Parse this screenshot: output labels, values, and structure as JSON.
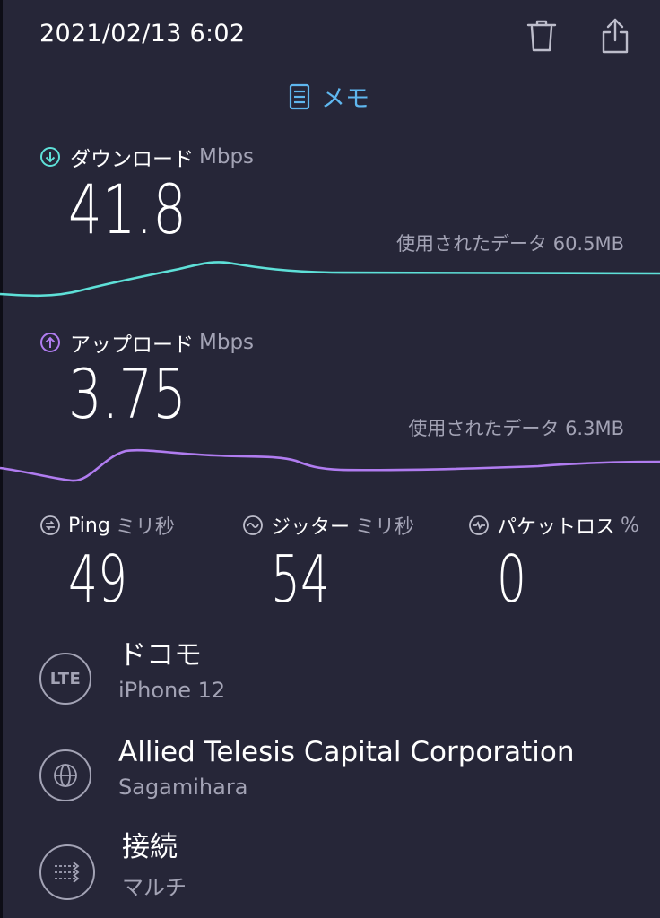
{
  "header": {
    "timestamp": "2021/02/13 6:02",
    "memo_label": "メモ"
  },
  "download": {
    "label": "ダウンロード",
    "unit": "Mbps",
    "value": "41.8",
    "data_used": "使用されたデータ 60.5MB",
    "color": "#5ee0d8"
  },
  "upload": {
    "label": "アップロード",
    "unit": "Mbps",
    "value": "3.75",
    "data_used": "使用されたデータ 6.3MB",
    "color": "#b07cf0"
  },
  "stats": {
    "ping": {
      "label": "Ping",
      "unit": "ミリ秒",
      "value": "49"
    },
    "jitter": {
      "label": "ジッター",
      "unit": "ミリ秒",
      "value": "54"
    },
    "packet_loss": {
      "label": "パケットロス",
      "unit": "%",
      "value": "0"
    }
  },
  "carrier": {
    "badge": "LTE",
    "name": "ドコモ",
    "device": "iPhone 12"
  },
  "provider": {
    "name": "Allied Telesis Capital Corporation",
    "location": "Sagamihara"
  },
  "connection": {
    "label": "接続",
    "mode": "マルチ"
  },
  "icons": {
    "trash": "trash-icon",
    "share": "share-icon",
    "memo": "memo-icon",
    "download": "download-icon",
    "upload": "upload-icon",
    "ping": "ping-icon",
    "jitter": "jitter-icon",
    "packet_loss": "packet-loss-icon",
    "globe": "globe-icon",
    "connections": "connections-icon"
  }
}
